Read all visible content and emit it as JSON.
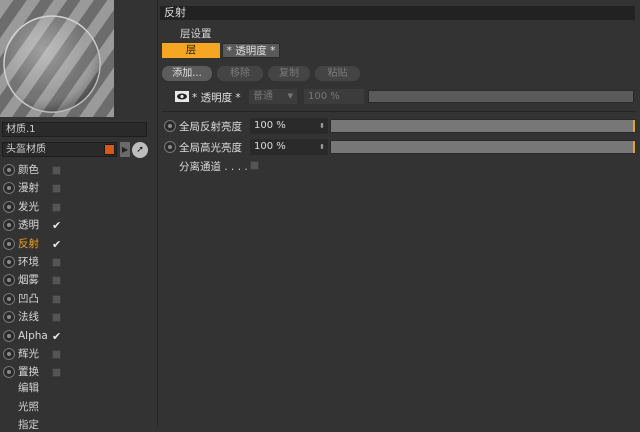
{
  "material": {
    "name": "材质.1",
    "type": "头盔材质",
    "swatch_color": "#d25a1e"
  },
  "channels": [
    {
      "label": "颜色",
      "checked": false,
      "active": false
    },
    {
      "label": "漫射",
      "checked": false,
      "active": false
    },
    {
      "label": "发光",
      "checked": false,
      "active": false
    },
    {
      "label": "透明",
      "checked": true,
      "active": false
    },
    {
      "label": "反射",
      "checked": true,
      "active": true
    },
    {
      "label": "环境",
      "checked": false,
      "active": false
    },
    {
      "label": "烟雾",
      "checked": false,
      "active": false
    },
    {
      "label": "凹凸",
      "checked": false,
      "active": false
    },
    {
      "label": "法线",
      "checked": false,
      "active": false
    },
    {
      "label": "Alpha",
      "checked": true,
      "active": false
    },
    {
      "label": "辉光",
      "checked": false,
      "active": false
    },
    {
      "label": "置换",
      "checked": false,
      "active": false
    }
  ],
  "extras": [
    "编辑",
    "光照",
    "指定"
  ],
  "section": {
    "title": "反射",
    "layer_settings_label": "层设置",
    "tabs": [
      {
        "label": "层",
        "active": true
      },
      {
        "label": "* 透明度 *",
        "active": false
      }
    ],
    "actions": {
      "add": "添加...",
      "remove": "移除",
      "copy": "复制",
      "paste": "粘贴"
    },
    "layer": {
      "name": "* 透明度 *",
      "blend_mode": "普通",
      "opacity": "100 %"
    },
    "params": {
      "global_reflection_label": "全局反射亮度",
      "global_reflection_value": "100 %",
      "global_specular_label": "全局高光亮度",
      "global_specular_value": "100 %",
      "separate_pass_label": "分离通道 . . . ."
    }
  },
  "colors": {
    "accent": "#f5a623",
    "background": "#333333"
  }
}
